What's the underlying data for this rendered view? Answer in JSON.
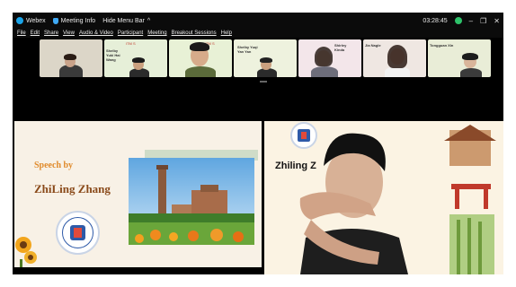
{
  "titlebar": {
    "app": "Webex",
    "meeting_info": "Meeting Info",
    "hide_menu": "Hide Menu Bar",
    "time": "03:28:45"
  },
  "menu": [
    "File",
    "Edit",
    "Share",
    "View",
    "Audio & Video",
    "Participant",
    "Meeting",
    "Breakout Sessions",
    "Help"
  ],
  "participants": [
    {
      "name": ""
    },
    {
      "name": "Shelby Yuki Hai Wang"
    },
    {
      "name": ""
    },
    {
      "name": "Shelby Yuqi Yan Yan"
    },
    {
      "name": "Shirley Kinda"
    },
    {
      "name": "Jia Nagle"
    },
    {
      "name": "Tongguan Xin"
    }
  ],
  "badge": "ITM S",
  "slide": {
    "speech_by": "Speech by",
    "speaker": "ZhiLing Zhang"
  },
  "camera": {
    "overlay_text": "Zhiling Z"
  },
  "colors": {
    "accent_orange": "#e08a2a",
    "name_brown": "#8a4a1a",
    "status_green": "#2ec26a"
  }
}
